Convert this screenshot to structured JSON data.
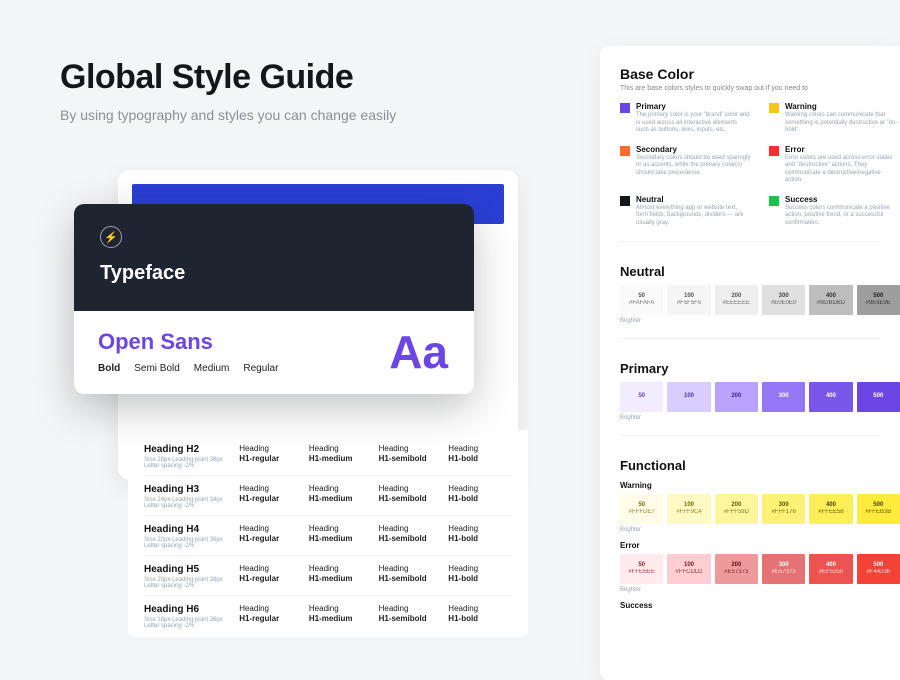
{
  "hero": {
    "title": "Global Style Guide",
    "subtitle": "By using typography and styles you can change easily"
  },
  "typeface": {
    "card_title": "Typeface",
    "icon_name": "bolt-circle",
    "font_name": "Open Sans",
    "sample_glyph": "Aa",
    "weights": [
      "Bold",
      "Semi Bold",
      "Medium",
      "Regular"
    ],
    "variant_label": "Heading",
    "variants": [
      "H1-regular",
      "H1-medium",
      "H1-semibold",
      "H1-bold"
    ],
    "headings": [
      {
        "name": "Heading H2",
        "meta": "Size 28px   Leading point 38px   Letter spacing -2%"
      },
      {
        "name": "Heading H3",
        "meta": "Size 24px   Leading point 34px   Letter spacing -2%"
      },
      {
        "name": "Heading H4",
        "meta": "Size 22px   Leading point 30px   Letter spacing -2%"
      },
      {
        "name": "Heading H5",
        "meta": "Size 20px   Leading point 28px   Letter spacing -2%"
      },
      {
        "name": "Heading H6",
        "meta": "Size 18px   Leading point 26px   Letter spacing -2%"
      }
    ]
  },
  "colors": {
    "base_title": "Base Color",
    "base_sub": "This are base colors styles to quickly swap out if you need to",
    "base": [
      {
        "name": "Primary",
        "swatch": "#6b46e5",
        "desc": "The primary color is your \"brand\" color and is used across all interactive elements such as buttons, links, inputs, etc."
      },
      {
        "name": "Warning",
        "swatch": "#f5c518",
        "desc": "Warning colors can communicate that something is potentially destructive or \"on-hold\"."
      },
      {
        "name": "Secondary",
        "swatch": "#ff6b2c",
        "desc": "Secondary colors should be used sparingly or as accents, while the primary color(s) should take precedence."
      },
      {
        "name": "Error",
        "swatch": "#ff2d2d",
        "desc": "Error colors are used across error states and \"destructive\" actions. They communicate a destructive/negative action."
      },
      {
        "name": "Neutral",
        "swatch": "#14161a",
        "desc": "Almost everything app or website text, form fields, backgrounds, dividers — are usually gray."
      },
      {
        "name": "Success",
        "swatch": "#1fbf4b",
        "desc": "Success colors communicate a positive action, positive trend, or a successful confirmation."
      }
    ],
    "brighter_label": "Brighter",
    "neutral": {
      "title": "Neutral",
      "swatches": [
        {
          "level": "50",
          "hex": "#FAFAFA",
          "bg": "#fafafa",
          "fg": "#555"
        },
        {
          "level": "100",
          "hex": "#F5F5F5",
          "bg": "#f5f5f5",
          "fg": "#555"
        },
        {
          "level": "200",
          "hex": "#EEEEEE",
          "bg": "#eeeeee",
          "fg": "#555"
        },
        {
          "level": "300",
          "hex": "#E0E0E0",
          "bg": "#e0e0e0",
          "fg": "#444"
        },
        {
          "level": "400",
          "hex": "#BDBDBD",
          "bg": "#bdbdbd",
          "fg": "#333"
        },
        {
          "level": "500",
          "hex": "#9E9E9E",
          "bg": "#9e9e9e",
          "fg": "#222"
        }
      ]
    },
    "primary": {
      "title": "Primary",
      "swatches": [
        {
          "level": "50",
          "hex": "",
          "bg": "#f2ecff",
          "fg": "#5a3fc4"
        },
        {
          "level": "100",
          "hex": "",
          "bg": "#d9ccff",
          "fg": "#4b32b0"
        },
        {
          "level": "200",
          "hex": "",
          "bg": "#b9a3ff",
          "fg": "#3a2690"
        },
        {
          "level": "300",
          "hex": "",
          "bg": "#9577f5",
          "fg": "#fff"
        },
        {
          "level": "400",
          "hex": "",
          "bg": "#7a56ea",
          "fg": "#fff"
        },
        {
          "level": "500",
          "hex": "",
          "bg": "#6b46e5",
          "fg": "#fff"
        }
      ]
    },
    "functional": {
      "title": "Functional",
      "warning": {
        "title": "Warning",
        "swatches": [
          {
            "level": "50",
            "hex": "#FFFDE7",
            "bg": "#fffde7",
            "fg": "#7a6a00"
          },
          {
            "level": "100",
            "hex": "#FFF9C4",
            "bg": "#fff9c4",
            "fg": "#7a6a00"
          },
          {
            "level": "200",
            "hex": "#FFF59D",
            "bg": "#fff59d",
            "fg": "#6a5c00"
          },
          {
            "level": "300",
            "hex": "#FFF176",
            "bg": "#fff176",
            "fg": "#5a4e00"
          },
          {
            "level": "400",
            "hex": "#FFEE58",
            "bg": "#ffee58",
            "fg": "#4a4000"
          },
          {
            "level": "500",
            "hex": "#FFEB3B",
            "bg": "#ffeb3b",
            "fg": "#4a4000"
          }
        ]
      },
      "error": {
        "title": "Error",
        "swatches": [
          {
            "level": "50",
            "hex": "#FFEBEE",
            "bg": "#ffebee",
            "fg": "#8a1c1c"
          },
          {
            "level": "100",
            "hex": "#FFCDD2",
            "bg": "#ffcdd2",
            "fg": "#7a1616"
          },
          {
            "level": "200",
            "hex": "#E57373",
            "bg": "#ef9a9a",
            "fg": "#5a0e0e"
          },
          {
            "level": "300",
            "hex": "#E57373",
            "bg": "#e57373",
            "fg": "#fff"
          },
          {
            "level": "400",
            "hex": "#EF5350",
            "bg": "#ef5350",
            "fg": "#fff"
          },
          {
            "level": "500",
            "hex": "#F44336",
            "bg": "#f44336",
            "fg": "#fff"
          }
        ]
      },
      "success": {
        "title": "Success"
      }
    }
  }
}
